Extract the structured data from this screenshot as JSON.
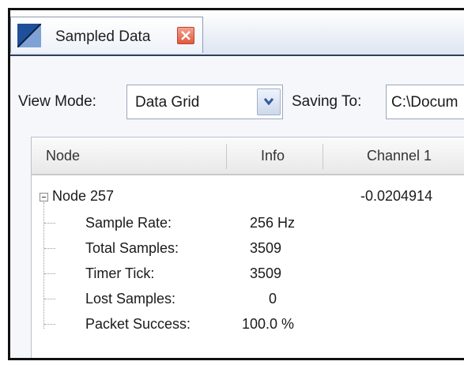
{
  "window": {
    "tab_title": "Sampled Data",
    "tab_icon": "chart-icon",
    "close_icon": "close-icon"
  },
  "toolbar": {
    "view_mode_label": "View Mode:",
    "view_mode_value": "Data Grid",
    "dropdown_icon": "chevron-down-icon",
    "saving_to_label": "Saving To:",
    "saving_to_value": "C:\\Docum"
  },
  "grid": {
    "columns": [
      "Node",
      "Info",
      "Channel 1"
    ],
    "node": {
      "name": "Node 257",
      "channel_1": "-0.0204914",
      "children": [
        {
          "label": "Sample Rate:",
          "info": "256 Hz"
        },
        {
          "label": "Total Samples:",
          "info": "3509"
        },
        {
          "label": "Timer Tick:",
          "info": "3509"
        },
        {
          "label": "Lost Samples:",
          "info": "0"
        },
        {
          "label": "Packet Success:",
          "info": "100.0 %"
        }
      ]
    }
  },
  "colors": {
    "tab_icon_blue": "#1f4f9a",
    "close_red": "#e1583e",
    "header_separator": "#2f3f5a"
  }
}
